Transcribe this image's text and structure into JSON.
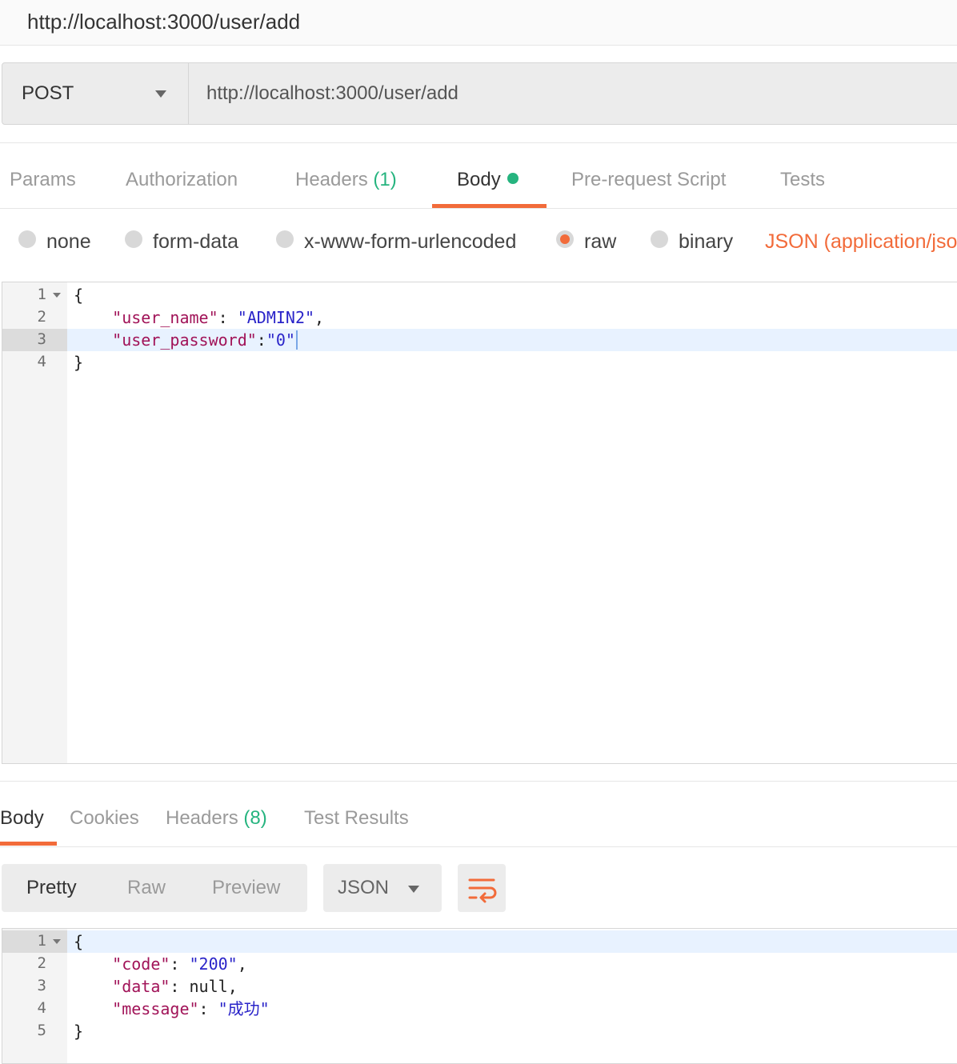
{
  "title": "http://localhost:3000/user/add",
  "request": {
    "method": "POST",
    "url": "http://localhost:3000/user/add"
  },
  "request_tabs": {
    "params": "Params",
    "authorization": "Authorization",
    "headers": "Headers",
    "headers_count": "(1)",
    "body": "Body",
    "pre_request": "Pre-request Script",
    "tests": "Tests"
  },
  "body_types": {
    "none": "none",
    "form_data": "form-data",
    "urlencoded": "x-www-form-urlencoded",
    "raw": "raw",
    "binary": "binary",
    "selected": "raw",
    "content_type": "JSON (application/json)"
  },
  "request_body": {
    "line_numbers": [
      "1",
      "2",
      "3",
      "4"
    ],
    "open_brace": "{",
    "key1": "\"user_name\"",
    "sep1": ": ",
    "val1": "\"ADMIN2\"",
    "comma1": ",",
    "key2": "\"user_password\"",
    "sep2": ":",
    "val2": "\"0\"",
    "close_brace": "}"
  },
  "response_tabs": {
    "body": "Body",
    "cookies": "Cookies",
    "headers": "Headers",
    "headers_count": "(8)",
    "test_results": "Test Results"
  },
  "view_modes": {
    "pretty": "Pretty",
    "raw": "Raw",
    "preview": "Preview",
    "format": "JSON"
  },
  "response_body": {
    "line_numbers": [
      "1",
      "2",
      "3",
      "4",
      "5"
    ],
    "open_brace": "{",
    "key1": "\"code\"",
    "sep1": ": ",
    "val1": "\"200\"",
    "comma1": ",",
    "key2": "\"data\"",
    "sep2": ": ",
    "val2": "null",
    "comma2": ",",
    "key3": "\"message\"",
    "sep3": ": ",
    "val3": "\"成功\"",
    "close_brace": "}"
  },
  "colors": {
    "accent": "#f26b3a",
    "count_green": "#26b47f",
    "json_key": "#a11358",
    "json_string": "#2a24c9"
  },
  "icons": {
    "method_dropdown": "chevron-down-icon",
    "fold": "fold-arrow-icon",
    "format_dropdown": "chevron-down-icon",
    "wrap": "wrap-lines-icon"
  }
}
